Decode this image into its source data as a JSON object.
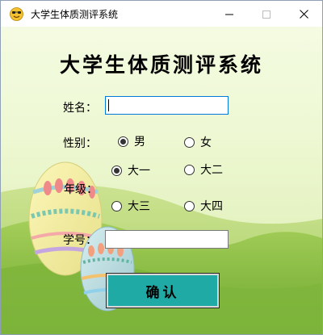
{
  "window": {
    "title": "大学生体质测评系统",
    "icon": "smiley-face-icon",
    "controls": [
      "minimize-icon",
      "maximize-icon",
      "close-icon"
    ]
  },
  "form": {
    "heading": "大学生体质测评系统",
    "name_label": "姓名：",
    "name_value": "",
    "gender_label": "性别：",
    "gender_options": [
      {
        "label": "男",
        "checked": true
      },
      {
        "label": "女",
        "checked": false
      }
    ],
    "grade_label": "年级：",
    "grade_options": [
      {
        "label": "大一",
        "checked": true
      },
      {
        "label": "大二",
        "checked": false
      },
      {
        "label": "大三",
        "checked": false
      },
      {
        "label": "大四",
        "checked": false
      }
    ],
    "student_id_label": "学号：",
    "student_id_value": "",
    "confirm_label": "确认"
  },
  "colors": {
    "background": "#eef8d3",
    "hill_green": "#7fb53c",
    "button": "#20aaa6",
    "focus_border": "#0078d7"
  }
}
